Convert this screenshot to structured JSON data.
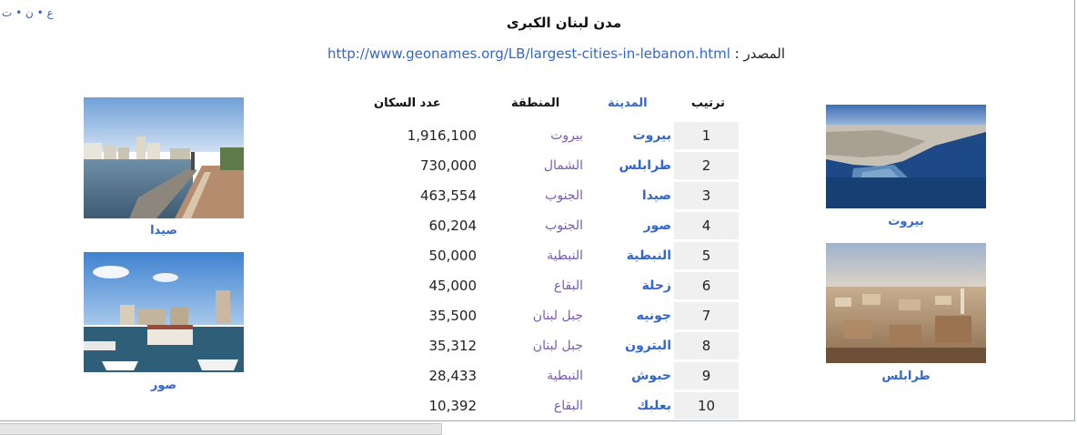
{
  "nav_links": "ع • ن • ت",
  "title": "مدن لبنان الكبرى",
  "source": {
    "label": "المصدر :",
    "url": "http://www.geonames.org/LB/largest-cities-in-lebanon.html"
  },
  "headers": {
    "rank": "ترتيب",
    "city": "المدينة",
    "region": "المنطقة",
    "population": "عدد السكان"
  },
  "rows": [
    {
      "rank": "1",
      "city": "بيروت",
      "region": "بيروت",
      "population": "1,916,100"
    },
    {
      "rank": "2",
      "city": "طرابلس",
      "region": "الشمال",
      "population": "730,000"
    },
    {
      "rank": "3",
      "city": "صيدا",
      "region": "الجنوب",
      "population": "463,554"
    },
    {
      "rank": "4",
      "city": "صور",
      "region": "الجنوب",
      "population": "60,204"
    },
    {
      "rank": "5",
      "city": "النبطية",
      "region": "النبطية",
      "population": "50,000"
    },
    {
      "rank": "6",
      "city": "زحلة",
      "region": "البقاع",
      "population": "45,000"
    },
    {
      "rank": "7",
      "city": "جونيه",
      "region": "جبل لبنان",
      "population": "35,500"
    },
    {
      "rank": "8",
      "city": "البترون",
      "region": "جبل لبنان",
      "population": "35,312"
    },
    {
      "rank": "9",
      "city": "حبوش",
      "region": "النبطية",
      "population": "28,433"
    },
    {
      "rank": "10",
      "city": "بعلبك",
      "region": "البقاع",
      "population": "10,392"
    }
  ],
  "photos": {
    "beirut": "بيروت",
    "tripoli": "طرابلس",
    "sidon": "صيدا",
    "tyre": "صور"
  },
  "colors": {
    "link": "#3366cc",
    "visited_link": "#795cb2",
    "rank_cell": "#f0f0f0"
  }
}
